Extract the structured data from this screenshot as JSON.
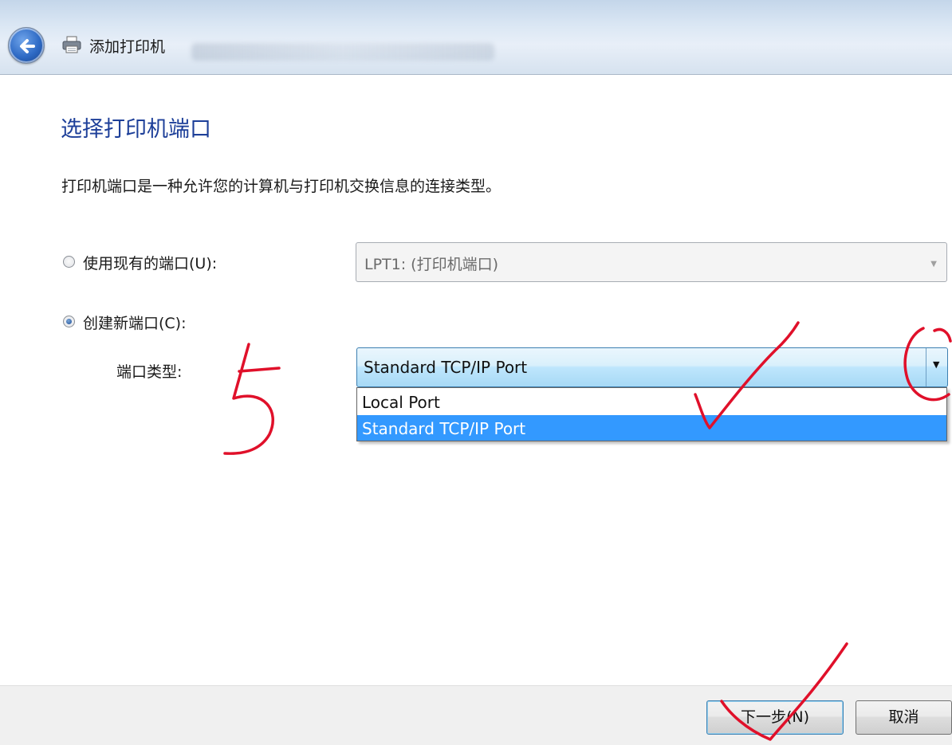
{
  "window": {
    "title": "添加打印机",
    "back_icon": "back-arrow-icon",
    "app_icon": "printer-icon"
  },
  "page": {
    "heading": "选择打印机端口",
    "description": "打印机端口是一种允许您的计算机与打印机交换信息的连接类型。"
  },
  "options": {
    "existing_port": {
      "label": "使用现有的端口(U):",
      "checked": false,
      "value": "LPT1: (打印机端口)"
    },
    "new_port": {
      "label": "创建新端口(C):",
      "checked": true
    },
    "port_type": {
      "label": "端口类型:",
      "value": "Standard TCP/IP Port",
      "dropdown_open": true,
      "items": [
        "Local Port",
        "Standard TCP/IP Port"
      ],
      "selected_index": 1
    }
  },
  "footer": {
    "next_label": "下一步(N)",
    "cancel_label": "取消"
  },
  "colors": {
    "heading": "#1d3f99",
    "selection": "#3399ff",
    "annotation_ink": "#e0102a"
  }
}
